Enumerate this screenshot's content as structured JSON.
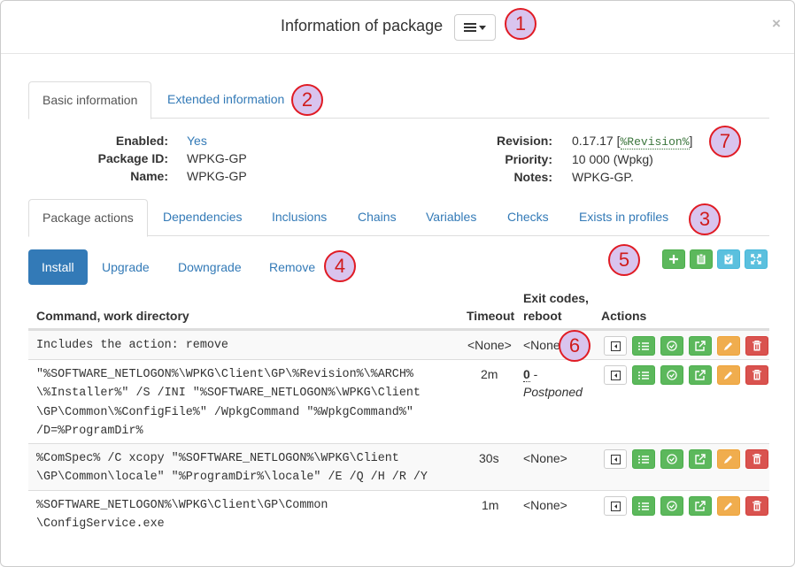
{
  "header": {
    "title": "Information of package",
    "close_glyph": "×"
  },
  "markers": [
    "1",
    "2",
    "3",
    "4",
    "5",
    "6",
    "7"
  ],
  "info_tabs": [
    {
      "label": "Basic information",
      "active": true
    },
    {
      "label": "Extended information",
      "active": false
    }
  ],
  "basic": {
    "enabled_label": "Enabled:",
    "enabled_value": "Yes",
    "package_id_label": "Package ID:",
    "package_id_value": "WPKG-GP",
    "name_label": "Name:",
    "name_value": "WPKG-GP",
    "revision_label": "Revision:",
    "revision_value": "0.17.17",
    "revision_open": "[",
    "revision_var": "%Revision%",
    "revision_close": "]",
    "priority_label": "Priority:",
    "priority_value": "10 000 (Wpkg)",
    "notes_label": "Notes:",
    "notes_value": "WPKG-GP."
  },
  "section_tabs": [
    {
      "label": "Package actions",
      "active": true
    },
    {
      "label": "Dependencies"
    },
    {
      "label": "Inclusions"
    },
    {
      "label": "Chains"
    },
    {
      "label": "Variables"
    },
    {
      "label": "Checks"
    },
    {
      "label": "Exists in profiles"
    }
  ],
  "action_tabs": [
    {
      "label": "Install",
      "active": true
    },
    {
      "label": "Upgrade"
    },
    {
      "label": "Downgrade"
    },
    {
      "label": "Remove"
    }
  ],
  "toolbar_icons": [
    "plus-icon",
    "clipboard-icon",
    "clipboard-check-icon",
    "expand-icon"
  ],
  "table": {
    "headers": {
      "command": "Command, work directory",
      "timeout": "Timeout",
      "exit_line1": "Exit codes,",
      "exit_line2": "reboot",
      "actions": "Actions"
    },
    "rows": [
      {
        "command": [
          "Includes the action: remove"
        ],
        "timeout": "<None>",
        "exit": "<None>"
      },
      {
        "command": [
          "\"%SOFTWARE_NETLOGON%\\WPKG\\Client\\GP\\%Revision%\\%ARCH%",
          "\\%Installer%\" /S /INI \"%SOFTWARE_NETLOGON%\\WPKG\\Client",
          "\\GP\\Common\\%ConfigFile%\" /WpkgCommand \"%WpkgCommand%\"",
          "/D=%ProgramDir%"
        ],
        "timeout": "2m",
        "exit_code": "0",
        "exit_sep": " -",
        "exit_reboot": "Postponed"
      },
      {
        "command": [
          "%ComSpec% /C xcopy \"%SOFTWARE_NETLOGON%\\WPKG\\Client",
          "\\GP\\Common\\locale\" \"%ProgramDir%\\locale\" /E /Q /H /R /Y"
        ],
        "timeout": "30s",
        "exit": "<None>"
      },
      {
        "command": [
          "%SOFTWARE_NETLOGON%\\WPKG\\Client\\GP\\Common",
          "\\ConfigService.exe"
        ],
        "timeout": "1m",
        "exit": "<None>"
      }
    ],
    "row_action_icons": [
      "move-icon",
      "list-icon",
      "check-circle-icon",
      "external-link-icon",
      "pencil-icon",
      "trash-icon"
    ]
  },
  "colors": {
    "primary": "#337ab7",
    "success": "#5cb85c",
    "info": "#5bc0de",
    "warning": "#f0ad4e",
    "danger": "#d9534f",
    "marker_fill": "#d9c4ee",
    "marker_border": "#e01b24",
    "variable": "#3c763d"
  }
}
